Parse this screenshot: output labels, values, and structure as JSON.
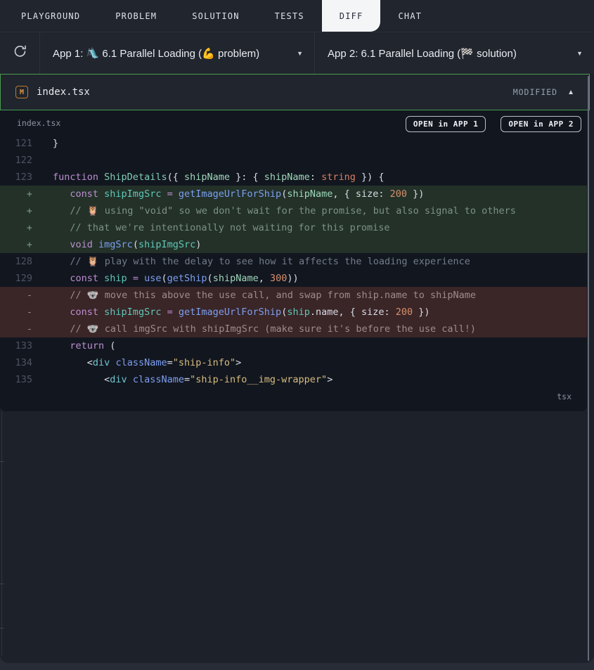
{
  "tabs": {
    "items": [
      {
        "label": "PLAYGROUND"
      },
      {
        "label": "PROBLEM"
      },
      {
        "label": "SOLUTION"
      },
      {
        "label": "TESTS"
      },
      {
        "label": "DIFF"
      },
      {
        "label": "CHAT"
      }
    ],
    "active": "DIFF"
  },
  "toolbar": {
    "refresh_icon": "circular-arrow",
    "app1_label": "App 1: 🛝 6.1 Parallel Loading (💪 problem)",
    "app2_label": "App 2: 6.1 Parallel Loading (🏁 solution)",
    "caret_icon": "▼"
  },
  "file_header": {
    "badge": "M",
    "filename": "index.tsx",
    "status": "MODIFIED",
    "collapse_icon": "▲"
  },
  "code_panel": {
    "filename_label": "index.tsx",
    "open_app1": "OPEN in APP 1",
    "open_app2": "OPEN in APP 2",
    "lang_label": "tsx",
    "lines": [
      {
        "num": "121",
        "type": "ctx",
        "segs": [
          [
            "pun",
            "}"
          ]
        ]
      },
      {
        "num": "122",
        "type": "ctx",
        "segs": []
      },
      {
        "num": "123",
        "type": "ctx",
        "segs": [
          [
            "kw",
            "function"
          ],
          [
            "pun",
            " "
          ],
          [
            "fndecl",
            "ShipDetails"
          ],
          [
            "pun",
            "({ "
          ],
          [
            "param",
            "shipName"
          ],
          [
            "pun",
            " }: { "
          ],
          [
            "param",
            "shipName"
          ],
          [
            "pun",
            ": "
          ],
          [
            "type",
            "string"
          ],
          [
            "pun",
            " }) {"
          ]
        ]
      },
      {
        "num": "+",
        "type": "add",
        "segs": [
          [
            "pun",
            "   "
          ],
          [
            "kw",
            "const"
          ],
          [
            "pun",
            " "
          ],
          [
            "var",
            "shipImgSrc"
          ],
          [
            "pun",
            " "
          ],
          [
            "op",
            "="
          ],
          [
            "pun",
            " "
          ],
          [
            "fn",
            "getImageUrlForShip"
          ],
          [
            "pun",
            "("
          ],
          [
            "param",
            "shipName"
          ],
          [
            "pun",
            ", { size: "
          ],
          [
            "num",
            "200"
          ],
          [
            "pun",
            " })"
          ]
        ]
      },
      {
        "num": "+",
        "type": "add",
        "segs": [
          [
            "cmt-add",
            "   // 🦉 using \"void\" so we don't wait for the promise, but also signal to others"
          ]
        ]
      },
      {
        "num": "+",
        "type": "add",
        "segs": [
          [
            "cmt-add",
            "   // that we're intentionally not waiting for this promise"
          ]
        ]
      },
      {
        "num": "+",
        "type": "add",
        "segs": [
          [
            "pun",
            "   "
          ],
          [
            "kw",
            "void"
          ],
          [
            "pun",
            " "
          ],
          [
            "fn",
            "imgSrc"
          ],
          [
            "pun",
            "("
          ],
          [
            "var",
            "shipImgSrc"
          ],
          [
            "pun",
            ")"
          ]
        ]
      },
      {
        "num": "128",
        "type": "ctx",
        "segs": [
          [
            "cmt",
            "   // 🦉 play with the delay to see how it affects the loading experience"
          ]
        ]
      },
      {
        "num": "129",
        "type": "ctx",
        "segs": [
          [
            "pun",
            "   "
          ],
          [
            "kw",
            "const"
          ],
          [
            "pun",
            " "
          ],
          [
            "var",
            "ship"
          ],
          [
            "pun",
            " "
          ],
          [
            "op",
            "="
          ],
          [
            "pun",
            " "
          ],
          [
            "fn",
            "use"
          ],
          [
            "pun",
            "("
          ],
          [
            "fn",
            "getShip"
          ],
          [
            "pun",
            "("
          ],
          [
            "param",
            "shipName"
          ],
          [
            "pun",
            ", "
          ],
          [
            "num",
            "300"
          ],
          [
            "pun",
            "))"
          ]
        ]
      },
      {
        "num": "-",
        "type": "del",
        "segs": [
          [
            "cmt-del",
            "   // 🐨 move this above the use call, and swap from ship.name to shipName"
          ]
        ]
      },
      {
        "num": "-",
        "type": "del",
        "segs": [
          [
            "pun",
            "   "
          ],
          [
            "kw",
            "const"
          ],
          [
            "pun",
            " "
          ],
          [
            "var",
            "shipImgSrc"
          ],
          [
            "pun",
            " "
          ],
          [
            "op",
            "="
          ],
          [
            "pun",
            " "
          ],
          [
            "fn",
            "getImageUrlForShip"
          ],
          [
            "pun",
            "("
          ],
          [
            "var",
            "ship"
          ],
          [
            "pun",
            ".name, { size: "
          ],
          [
            "num",
            "200"
          ],
          [
            "pun",
            " })"
          ]
        ]
      },
      {
        "num": "-",
        "type": "del",
        "segs": [
          [
            "cmt-del",
            "   // 🐨 call imgSrc with shipImgSrc (make sure it's before the use call!)"
          ]
        ]
      },
      {
        "num": "133",
        "type": "ctx",
        "segs": [
          [
            "pun",
            "   "
          ],
          [
            "kw",
            "return"
          ],
          [
            "pun",
            " ("
          ]
        ]
      },
      {
        "num": "134",
        "type": "ctx",
        "segs": [
          [
            "pun",
            "      <"
          ],
          [
            "tag",
            "div"
          ],
          [
            "pun",
            " "
          ],
          [
            "attr",
            "className"
          ],
          [
            "pun",
            "="
          ],
          [
            "str",
            "\"ship-info\""
          ],
          [
            "pun",
            ">"
          ]
        ]
      },
      {
        "num": "135",
        "type": "ctx",
        "segs": [
          [
            "pun",
            "         <"
          ],
          [
            "tag",
            "div"
          ],
          [
            "pun",
            " "
          ],
          [
            "attr",
            "className"
          ],
          [
            "pun",
            "="
          ],
          [
            "str",
            "\"ship-info__img-wrapper\""
          ],
          [
            "pun",
            ">"
          ]
        ]
      }
    ]
  },
  "colors": {
    "accent_green_border": "#4a9b50",
    "added_line_bg": "#233129",
    "deleted_line_bg": "#3a2527",
    "modified_badge_orange": "#dd9440",
    "active_tab_bg": "#f4f5f7",
    "panel_bg": "#12161f"
  }
}
